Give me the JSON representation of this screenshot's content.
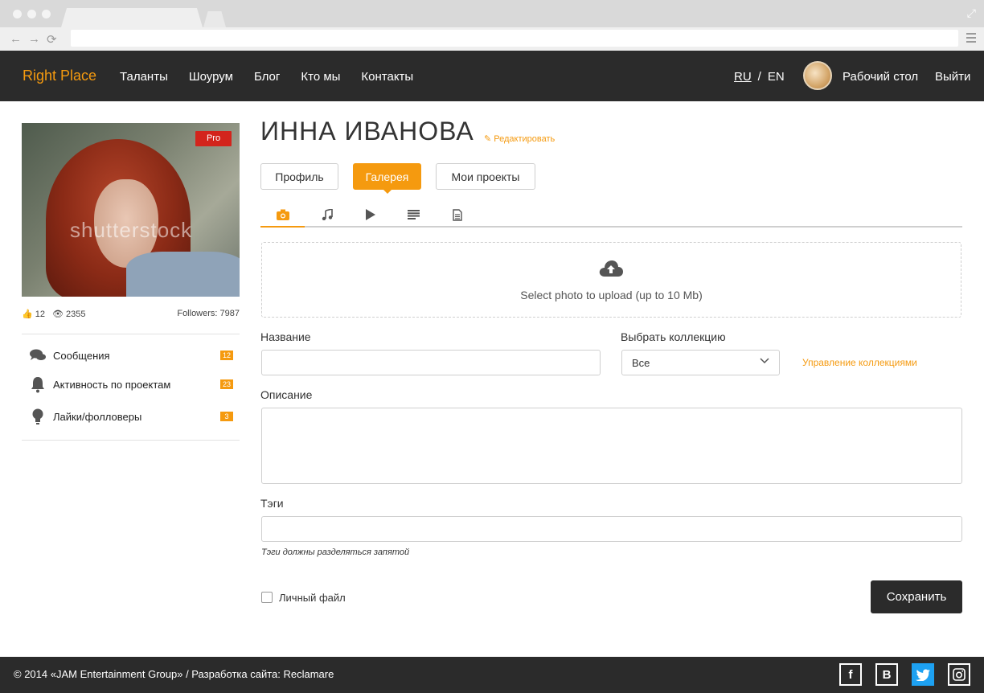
{
  "header": {
    "logo": "Right Place",
    "nav": [
      "Таланты",
      "Шоурум",
      "Блог",
      "Кто мы",
      "Контакты"
    ],
    "lang": {
      "ru": "RU",
      "sep": "/",
      "en": "EN"
    },
    "desk": "Рабочий стол",
    "logout": "Выйти"
  },
  "profile": {
    "badge": "Pro",
    "watermark": "shutterstock",
    "likes": "12",
    "views": "2355",
    "followers": "Followers: 7987",
    "menu": [
      {
        "label": "Сообщения",
        "count": "12",
        "icon": "chat-bubbles-icon"
      },
      {
        "label": "Активность по проектам",
        "count": "23",
        "icon": "bell-icon"
      },
      {
        "label": "Лайки/фолловеры",
        "count": "3",
        "icon": "lightbulb-icon"
      }
    ]
  },
  "main": {
    "name": "ИННА ИВАНОВА",
    "edit": "Редактировать",
    "tabs": [
      "Профиль",
      "Галерея",
      "Мои проекты"
    ],
    "media_tabs": [
      "camera-icon",
      "music-icon",
      "play-icon",
      "text-lines-icon",
      "document-icon"
    ],
    "upload_text": "Select photo to upload (up to 10 Mb)",
    "title_label": "Название",
    "collection_label": "Выбрать коллекцию",
    "collection_value": "Все",
    "manage_collections": "Управление коллекциями",
    "description_label": "Описание",
    "tags_label": "Тэги",
    "tags_hint": "Тэги должны разделяться запятой",
    "private_label": "Личный файл",
    "save": "Сохранить"
  },
  "footer": {
    "copyright": "© 2014 «JAM Entertainment Group»   /   Разработка сайта: Reclamare",
    "social": [
      "facebook-icon",
      "vk-icon",
      "twitter-icon",
      "instagram-icon"
    ]
  },
  "colors": {
    "accent": "#f59a0f",
    "dark": "#2b2b2b",
    "pro": "#d3241c"
  }
}
